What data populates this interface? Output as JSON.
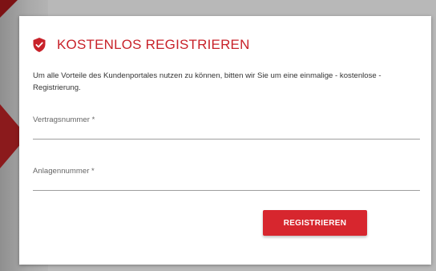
{
  "form": {
    "title": "KOSTENLOS REGISTRIEREN",
    "intro_text": "Um alle Vorteile des Kundenportales nutzen zu können, bitten wir Sie um eine einmalige - kostenlose - Registrierung.",
    "fields": [
      {
        "label": "Vertragsnummer *",
        "value": ""
      },
      {
        "label": "Anlagennummer *",
        "value": ""
      }
    ],
    "submit_label": "REGISTRIEREN",
    "header_icon": "shield-check-icon"
  },
  "colors": {
    "accent": "#d7262e",
    "title": "#c8222a",
    "background_accent": "#8b1a1c"
  }
}
